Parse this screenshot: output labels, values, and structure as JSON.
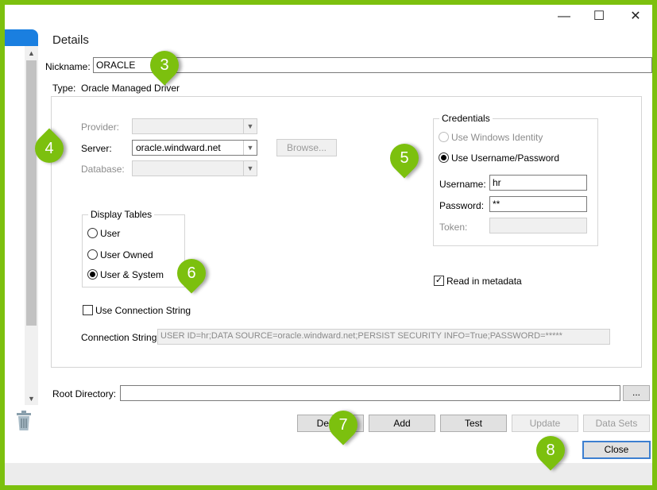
{
  "window": {
    "minimize": "—",
    "maximize": "☐",
    "close": "✕"
  },
  "title": "Details",
  "nickname": {
    "label": "Nickname:",
    "value": "ORACLE"
  },
  "type": {
    "label": "Type:",
    "value": "Oracle Managed Driver"
  },
  "provider": {
    "label": "Provider:",
    "value": ""
  },
  "server": {
    "label": "Server:",
    "value": "oracle.windward.net",
    "browse": "Browse..."
  },
  "database": {
    "label": "Database:",
    "value": ""
  },
  "display_tables": {
    "legend": "Display Tables",
    "options": [
      "User",
      "User Owned",
      "User & System"
    ],
    "selected": "User & System"
  },
  "credentials": {
    "legend": "Credentials",
    "windows_identity": "Use Windows Identity",
    "username_password": "Use Username/Password",
    "username_label": "Username:",
    "username": "hr",
    "password_label": "Password:",
    "password": "**",
    "token_label": "Token:",
    "token": ""
  },
  "read_metadata": {
    "label": "Read in metadata",
    "checked": true
  },
  "use_connection_string": {
    "label": "Use Connection String",
    "checked": false
  },
  "connection_string": {
    "label": "Connection String:",
    "value": "USER ID=hr;DATA SOURCE=oracle.windward.net;PERSIST SECURITY INFO=True;PASSWORD=*****"
  },
  "root_directory": {
    "label": "Root Directory:",
    "value": "",
    "browse": "..."
  },
  "buttons": {
    "delete": "Delete",
    "add": "Add",
    "test": "Test",
    "update": "Update",
    "data_sets": "Data Sets",
    "close": "Close"
  },
  "callouts": [
    "3",
    "4",
    "5",
    "6",
    "7",
    "8"
  ],
  "colors": {
    "accent": "#7cc00e",
    "selection": "#1a7fe0"
  },
  "icons": [
    "minimize-icon",
    "maximize-icon",
    "close-icon",
    "chevron-down-icon",
    "trash-icon",
    "checkmark-icon"
  ]
}
